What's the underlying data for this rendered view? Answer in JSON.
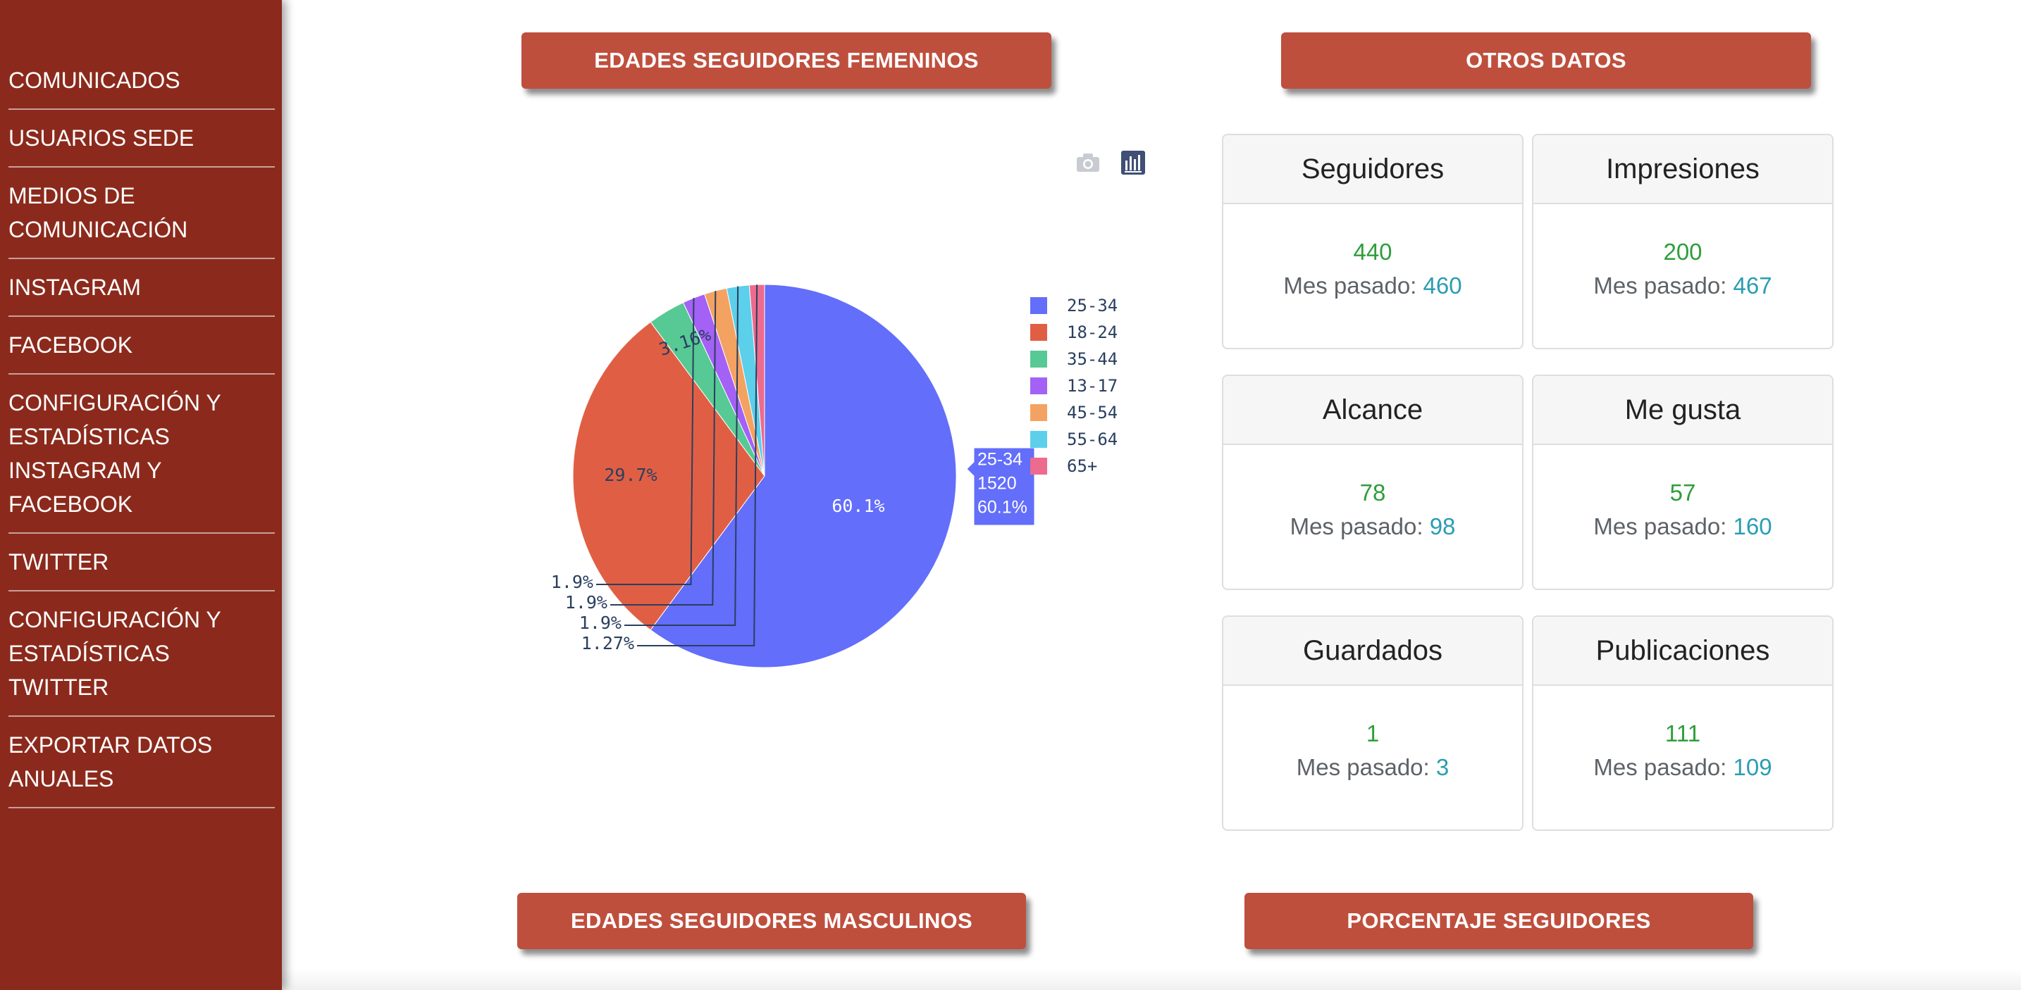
{
  "sidebar": {
    "items": [
      {
        "label": "COMUNICADOS",
        "lines": [
          "COMUNICADOS"
        ]
      },
      {
        "label": "USUARIOS SEDE",
        "lines": [
          "USUARIOS SEDE"
        ]
      },
      {
        "label": "MEDIOS DE COMUNICACIÓN",
        "lines": [
          "MEDIOS DE",
          "COMUNICACIÓN"
        ]
      },
      {
        "label": "INSTAGRAM",
        "lines": [
          "INSTAGRAM"
        ]
      },
      {
        "label": "FACEBOOK",
        "lines": [
          "FACEBOOK"
        ]
      },
      {
        "label": "CONFIGURACIÓN Y ESTADÍSTICAS INSTAGRAM Y FACEBOOK",
        "lines": [
          "CONFIGURACIÓN Y",
          "ESTADÍSTICAS",
          "INSTAGRAM Y FACEBOOK"
        ]
      },
      {
        "label": "TWITTER",
        "lines": [
          "TWITTER"
        ]
      },
      {
        "label": "CONFIGURACIÓN Y ESTADÍSTICAS TWITTER",
        "lines": [
          "CONFIGURACIÓN Y",
          "ESTADÍSTICAS TWITTER"
        ]
      },
      {
        "label": "EXPORTAR DATOS ANUALES",
        "lines": [
          "EXPORTAR DATOS",
          "ANUALES"
        ]
      }
    ]
  },
  "sections": {
    "female_ages": "EDADES SEGUIDORES FEMENINOS",
    "other_data": "OTROS DATOS",
    "male_ages": "EDADES SEGUIDORES MASCULINOS",
    "percent_followers": "PORCENTAJE SEGUIDORES"
  },
  "stats": {
    "prev_label": "Mes pasado: ",
    "cards": [
      {
        "title": "Seguidores",
        "current": "440",
        "previous": "460"
      },
      {
        "title": "Impresiones",
        "current": "200",
        "previous": "467"
      },
      {
        "title": "Alcance",
        "current": "78",
        "previous": "98"
      },
      {
        "title": "Me gusta",
        "current": "57",
        "previous": "160"
      },
      {
        "title": "Guardados",
        "current": "1",
        "previous": "3"
      },
      {
        "title": "Publicaciones",
        "current": "111",
        "previous": "109"
      }
    ]
  },
  "chart_data": {
    "type": "pie",
    "categories": [
      "25-34",
      "18-24",
      "35-44",
      "13-17",
      "45-54",
      "55-64",
      "65+"
    ],
    "values": [
      60.1,
      29.7,
      3.16,
      1.9,
      1.9,
      1.9,
      1.27
    ],
    "labels": [
      "60.1%",
      "29.7%",
      "3.16%",
      "1.9%",
      "1.9%",
      "1.9%",
      "1.27%"
    ],
    "colors": [
      "#636efa",
      "#e05f44",
      "#57c994",
      "#a461f5",
      "#f4a261",
      "#5ccfea",
      "#ec6b8e"
    ],
    "hover": {
      "category": "25-34",
      "count": "1520",
      "percent": "60.1%"
    },
    "legend_position": "right"
  },
  "toolbar": {
    "icons": [
      "camera-icon",
      "plotly-logo-icon"
    ]
  }
}
